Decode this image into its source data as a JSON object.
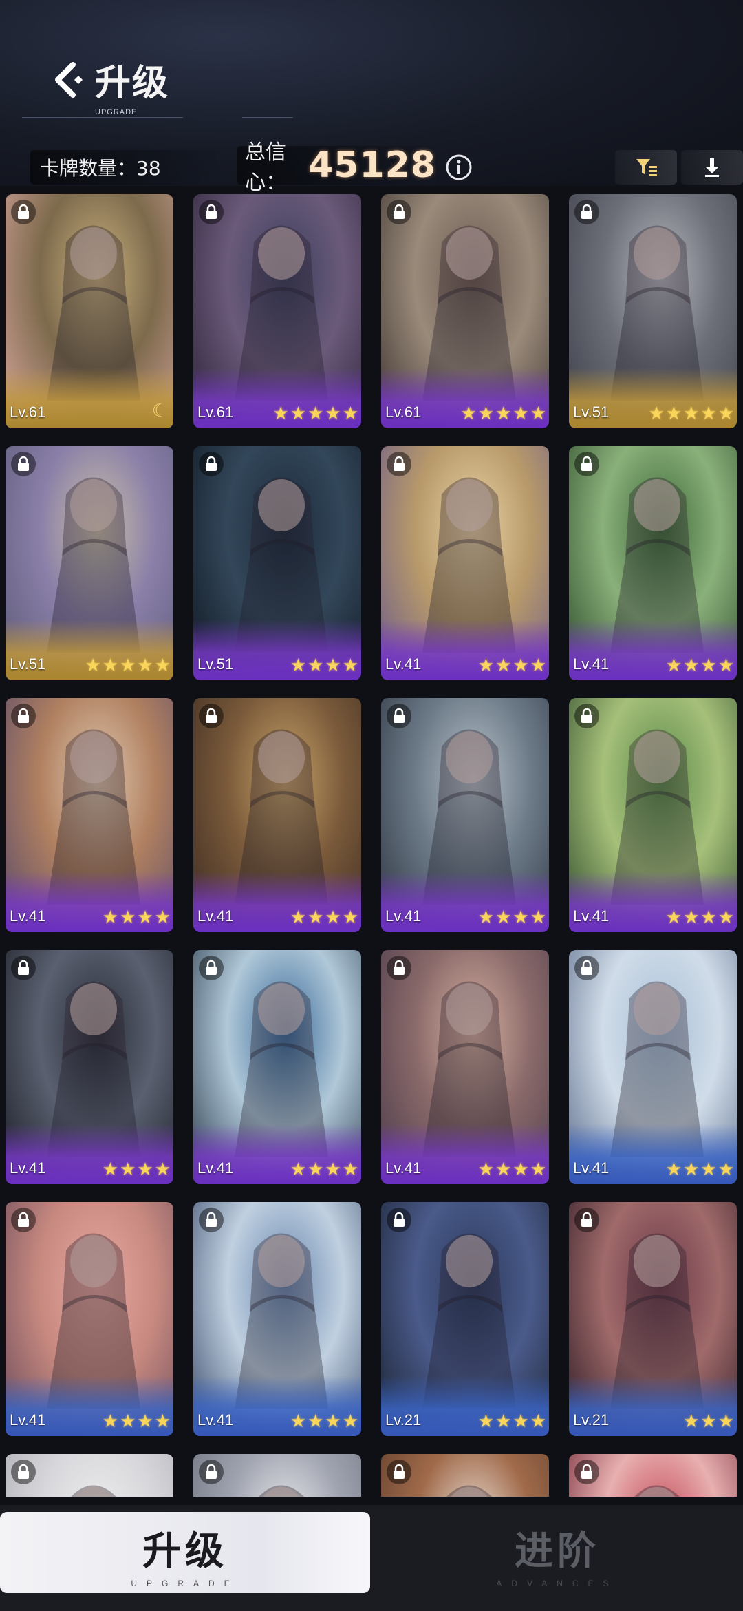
{
  "header": {
    "title": "升级",
    "subtitle": "UPGRADE"
  },
  "stats": {
    "card_count_label": "卡牌数量：38",
    "confidence_label": "总信心：",
    "confidence_value": "45128"
  },
  "icons": {
    "back": "back-chevron-icon",
    "info": "info-icon",
    "filter": "filter-icon",
    "download": "download-icon",
    "lock": "lock-icon"
  },
  "colors": {
    "star": "#f9d65a",
    "purple_foot": "#6a2fc0",
    "gold_foot": "#a9852e",
    "blue_foot": "#3657b8"
  },
  "cards": [
    {
      "level": "Lv.61",
      "stars": 0,
      "badge": "moon",
      "frame": "gold"
    },
    {
      "level": "Lv.61",
      "stars": 5,
      "frame": "purple"
    },
    {
      "level": "Lv.61",
      "stars": 5,
      "frame": "purple"
    },
    {
      "level": "Lv.51",
      "stars": 5,
      "frame": "gold"
    },
    {
      "level": "Lv.51",
      "stars": 5,
      "frame": "gold"
    },
    {
      "level": "Lv.51",
      "stars": 4,
      "frame": "purple"
    },
    {
      "level": "Lv.41",
      "stars": 4,
      "frame": "purple"
    },
    {
      "level": "Lv.41",
      "stars": 4,
      "frame": "purple"
    },
    {
      "level": "Lv.41",
      "stars": 4,
      "frame": "purple"
    },
    {
      "level": "Lv.41",
      "stars": 4,
      "frame": "purple"
    },
    {
      "level": "Lv.41",
      "stars": 4,
      "frame": "purple"
    },
    {
      "level": "Lv.41",
      "stars": 4,
      "frame": "purple"
    },
    {
      "level": "Lv.41",
      "stars": 4,
      "frame": "purple"
    },
    {
      "level": "Lv.41",
      "stars": 4,
      "frame": "purple"
    },
    {
      "level": "Lv.41",
      "stars": 4,
      "frame": "purple"
    },
    {
      "level": "Lv.41",
      "stars": 4,
      "frame": "blue"
    },
    {
      "level": "Lv.41",
      "stars": 4,
      "frame": "blue"
    },
    {
      "level": "Lv.41",
      "stars": 4,
      "frame": "blue"
    },
    {
      "level": "Lv.21",
      "stars": 4,
      "frame": "blue"
    },
    {
      "level": "Lv.21",
      "stars": 3,
      "frame": "blue"
    },
    {
      "level": "",
      "stars": 0,
      "frame": "none"
    },
    {
      "level": "",
      "stars": 0,
      "frame": "none"
    },
    {
      "level": "",
      "stars": 0,
      "frame": "none"
    },
    {
      "level": "",
      "stars": 0,
      "frame": "none"
    }
  ],
  "tabs": [
    {
      "label": "升级",
      "sub": "UPGRADE",
      "active": true
    },
    {
      "label": "进阶",
      "sub": "ADVANCES",
      "active": false
    }
  ]
}
